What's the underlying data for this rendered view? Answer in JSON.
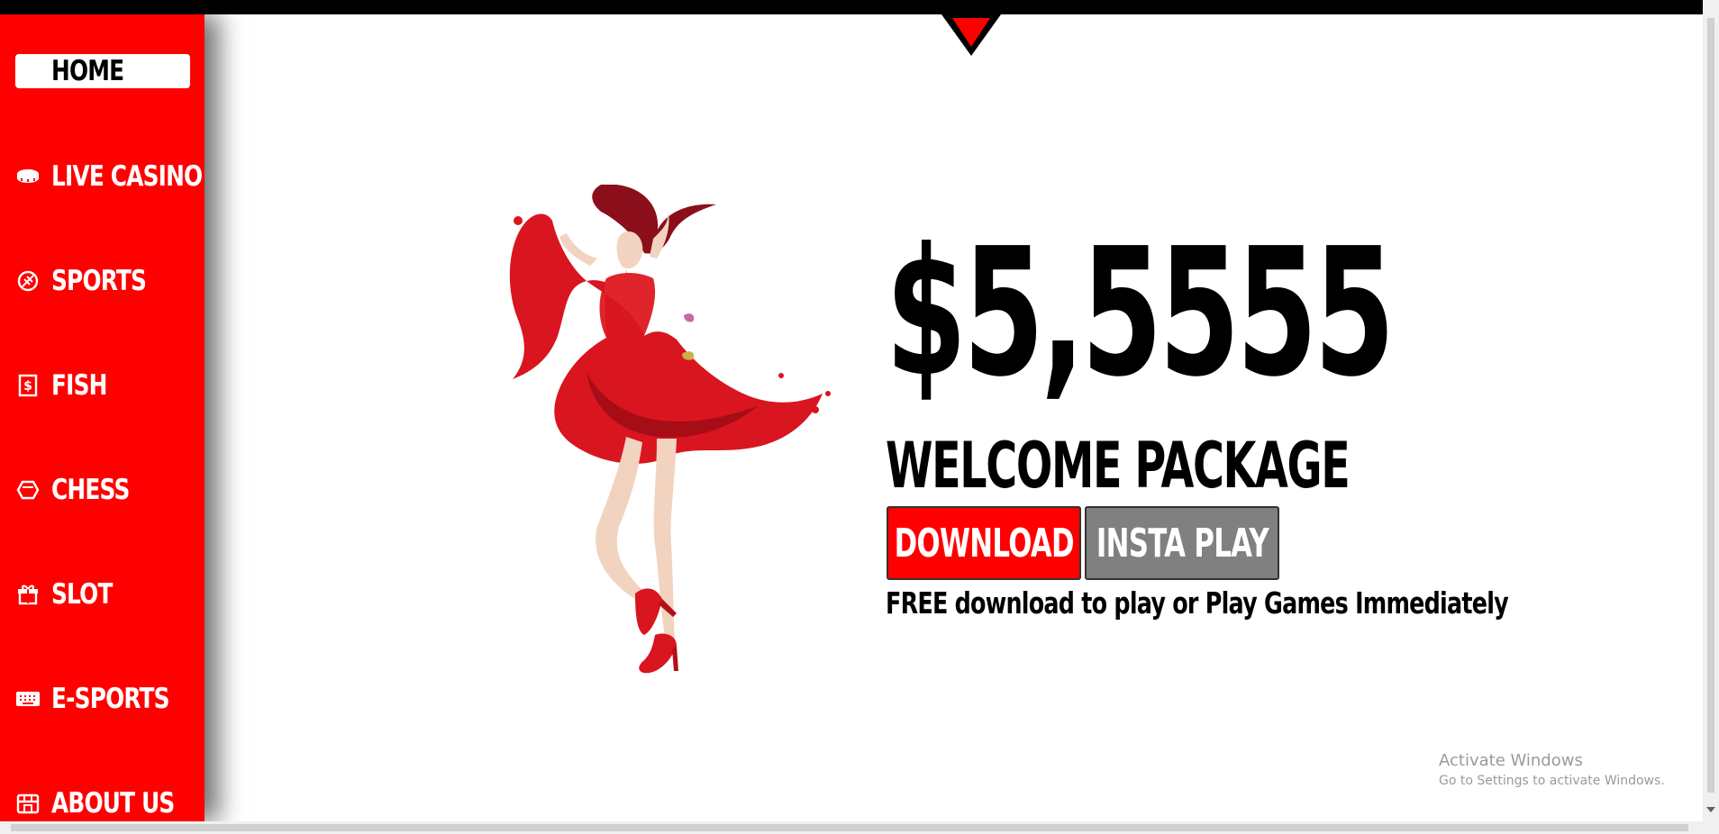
{
  "topbar": {
    "bg": "#000000",
    "notch_color": "#ff0000"
  },
  "sidebar": {
    "bg": "#ff0000",
    "items": [
      {
        "label": "HOME",
        "icon": "none",
        "active": true
      },
      {
        "label": "LIVE CASINO",
        "icon": "chip-icon"
      },
      {
        "label": "SPORTS",
        "icon": "ball-icon"
      },
      {
        "label": "FISH",
        "icon": "dollar-note-icon"
      },
      {
        "label": "CHESS",
        "icon": "hexagon-icon"
      },
      {
        "label": "SLOT",
        "icon": "gift-icon"
      },
      {
        "label": "E-SPORTS",
        "icon": "keyboard-icon"
      },
      {
        "label": "ABOUT US",
        "icon": "store-icon"
      }
    ]
  },
  "hero": {
    "image": "woman-red-dress",
    "amount": "$5,5555",
    "title": "WELCOME PACKAGE",
    "download_label": "DOWNLOAD",
    "insta_label": "INSTA PLAY",
    "caption": "FREE download to play or Play Games Immediately"
  },
  "watermark": {
    "title": "Activate Windows",
    "subtitle": "Go to Settings to activate Windows."
  }
}
